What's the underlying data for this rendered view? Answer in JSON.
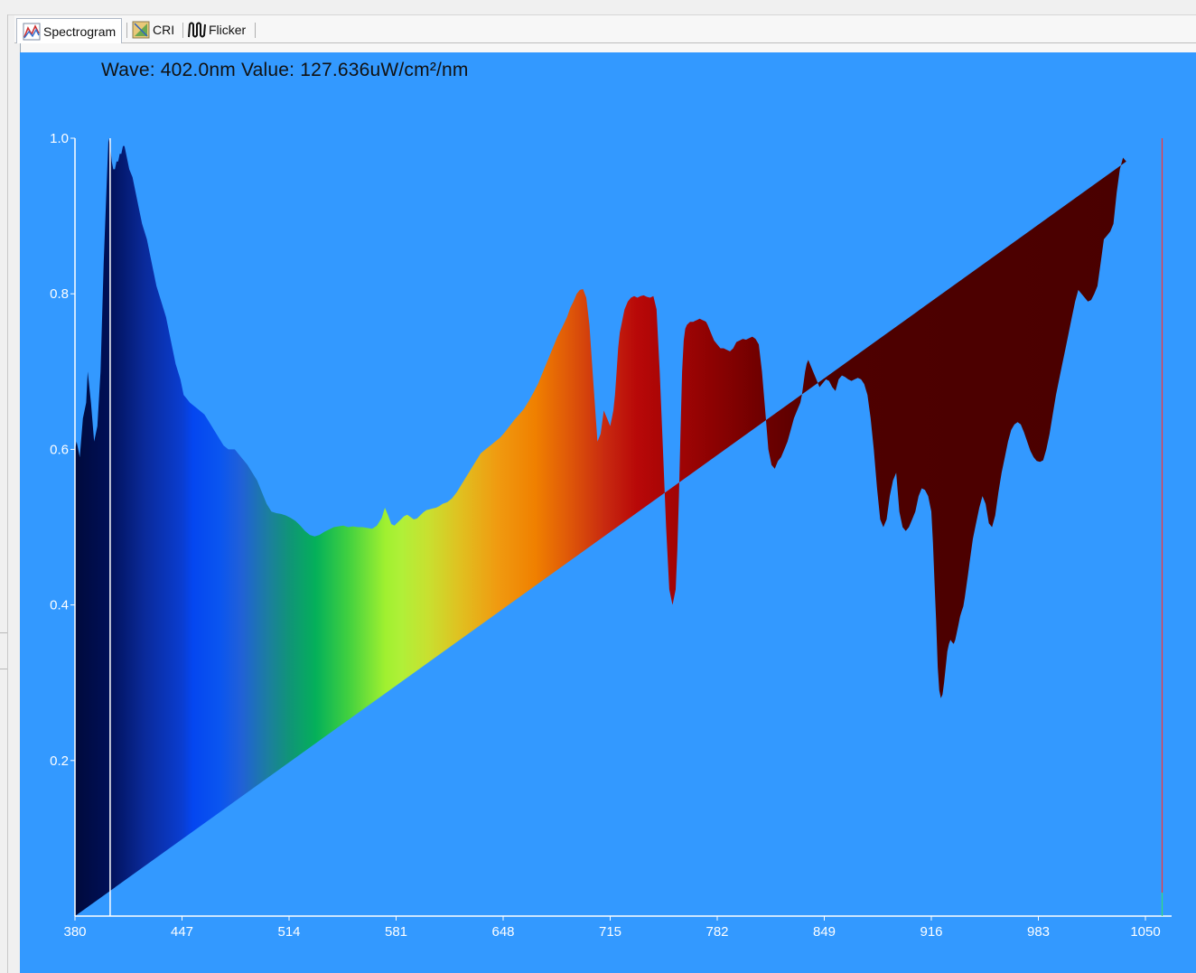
{
  "tabs": [
    {
      "label": "Spectrogram",
      "icon": "spectrogram-icon",
      "active": true
    },
    {
      "label": "CRI",
      "icon": "cri-icon",
      "active": false
    },
    {
      "label": "Flicker",
      "icon": "flicker-icon",
      "active": false
    }
  ],
  "readout": {
    "wave_label": "Wave:",
    "wave_value": "402.0nm",
    "value_label": "Value:",
    "value_value": "127.636uW/cm²/nm"
  },
  "colors": {
    "plot_background": "#3399ff",
    "axis": "#ffffff",
    "cursor_line": "#ffffff",
    "marker_red": "#ff3333",
    "marker_green": "#33dd77"
  },
  "chart_data": {
    "type": "area",
    "title": "",
    "xlabel": "",
    "ylabel": "",
    "xlim": [
      380,
      1050
    ],
    "ylim": [
      0,
      1.0
    ],
    "x_ticks": [
      "380",
      "447",
      "514",
      "581",
      "648",
      "715",
      "782",
      "849",
      "916",
      "983",
      "1050"
    ],
    "y_ticks": [
      "0.2",
      "0.4",
      "0.6",
      "0.8",
      "1.0"
    ],
    "cursor_wavelength": 402.0,
    "end_marker_wavelength": 1060,
    "x": [
      380,
      381,
      383,
      385,
      387,
      388,
      390,
      392,
      394,
      396,
      398,
      400,
      401,
      402,
      403,
      404,
      405,
      406,
      407,
      408,
      409,
      410,
      411,
      412,
      414,
      416,
      418,
      420,
      422,
      425,
      428,
      431,
      434,
      437,
      440,
      443,
      446,
      448,
      450,
      452,
      455,
      458,
      461,
      464,
      467,
      470,
      473,
      476,
      480,
      484,
      488,
      491,
      494,
      497,
      500,
      503,
      506,
      509,
      512,
      515,
      518,
      521,
      524,
      527,
      530,
      533,
      536,
      539,
      542,
      545,
      548,
      551,
      554,
      557,
      560,
      563,
      566,
      569,
      572,
      574,
      576,
      578,
      580,
      582,
      584,
      586,
      588,
      590,
      592,
      594,
      596,
      598,
      600,
      602,
      604,
      606,
      608,
      610,
      613,
      616,
      619,
      622,
      625,
      628,
      631,
      634,
      637,
      640,
      643,
      646,
      649,
      652,
      655,
      658,
      661,
      664,
      667,
      670,
      673,
      676,
      679,
      682,
      685,
      688,
      690,
      692,
      694,
      696,
      698,
      700,
      702,
      704,
      706,
      707,
      709,
      711,
      713,
      715,
      716,
      717,
      718,
      719,
      720,
      721,
      722,
      723,
      724,
      725,
      726,
      728,
      730,
      732,
      734,
      736,
      738,
      740,
      742,
      744,
      746,
      748,
      750,
      752,
      754,
      756,
      757,
      758,
      759,
      760,
      761,
      762,
      763,
      764,
      765,
      766,
      767,
      768,
      769,
      770,
      771,
      772,
      773,
      774,
      775,
      776,
      778,
      780,
      782,
      784,
      786,
      788,
      790,
      792,
      794,
      796,
      798,
      800,
      802,
      804,
      806,
      808,
      810,
      812,
      814,
      816,
      818,
      820,
      822,
      824,
      826,
      828,
      830,
      832,
      834,
      835,
      836,
      837,
      838,
      839,
      840,
      842,
      844,
      846,
      848,
      850,
      852,
      854,
      856,
      858,
      860,
      862,
      864,
      866,
      868,
      870,
      872,
      874,
      876,
      878,
      880,
      882,
      884,
      886,
      888,
      890,
      892,
      894,
      896,
      898,
      900,
      902,
      904,
      906,
      908,
      910,
      912,
      914,
      916,
      917,
      918,
      919,
      920,
      921,
      922,
      923,
      924,
      925,
      926,
      927,
      928,
      929,
      930,
      931,
      932,
      933,
      934,
      935,
      936,
      937,
      938,
      939,
      940,
      941,
      942,
      944,
      946,
      948,
      950,
      952,
      954,
      956,
      958,
      960,
      962,
      964,
      966,
      968,
      970,
      972,
      974,
      976,
      978,
      980,
      982,
      984,
      986,
      988,
      990,
      992,
      994,
      996,
      998,
      1000,
      1002,
      1004,
      1006,
      1008,
      1010,
      1012,
      1014,
      1016,
      1018,
      1020,
      1022,
      1024,
      1026,
      1028,
      1030,
      1032,
      1034,
      1036,
      1038,
      1040,
      1042,
      1044,
      1046,
      1048,
      1049,
      1050
    ],
    "values": [
      0.6,
      0.61,
      0.59,
      0.64,
      0.66,
      0.7,
      0.66,
      0.61,
      0.63,
      0.7,
      0.84,
      0.95,
      1.0,
      0.99,
      0.97,
      0.96,
      0.96,
      0.97,
      0.97,
      0.98,
      0.98,
      0.99,
      0.99,
      0.98,
      0.96,
      0.95,
      0.93,
      0.91,
      0.89,
      0.87,
      0.84,
      0.81,
      0.79,
      0.77,
      0.74,
      0.71,
      0.69,
      0.67,
      0.665,
      0.66,
      0.655,
      0.65,
      0.645,
      0.635,
      0.625,
      0.615,
      0.605,
      0.6,
      0.6,
      0.59,
      0.58,
      0.57,
      0.56,
      0.545,
      0.53,
      0.52,
      0.518,
      0.517,
      0.515,
      0.512,
      0.508,
      0.502,
      0.495,
      0.49,
      0.488,
      0.49,
      0.494,
      0.497,
      0.5,
      0.501,
      0.502,
      0.5,
      0.501,
      0.5,
      0.5,
      0.499,
      0.498,
      0.502,
      0.512,
      0.525,
      0.515,
      0.504,
      0.502,
      0.506,
      0.51,
      0.514,
      0.516,
      0.513,
      0.51,
      0.511,
      0.515,
      0.519,
      0.522,
      0.523,
      0.524,
      0.525,
      0.527,
      0.53,
      0.532,
      0.537,
      0.545,
      0.555,
      0.565,
      0.575,
      0.585,
      0.595,
      0.6,
      0.605,
      0.61,
      0.615,
      0.622,
      0.63,
      0.638,
      0.645,
      0.652,
      0.662,
      0.673,
      0.685,
      0.7,
      0.715,
      0.73,
      0.745,
      0.757,
      0.77,
      0.782,
      0.79,
      0.8,
      0.805,
      0.806,
      0.795,
      0.76,
      0.7,
      0.64,
      0.61,
      0.62,
      0.65,
      0.64,
      0.63,
      0.64,
      0.65,
      0.67,
      0.7,
      0.73,
      0.75,
      0.76,
      0.77,
      0.78,
      0.785,
      0.79,
      0.795,
      0.797,
      0.795,
      0.797,
      0.798,
      0.796,
      0.795,
      0.797,
      0.78,
      0.7,
      0.6,
      0.5,
      0.42,
      0.4,
      0.42,
      0.47,
      0.54,
      0.62,
      0.7,
      0.74,
      0.755,
      0.76,
      0.762,
      0.764,
      0.764,
      0.764,
      0.765,
      0.766,
      0.767,
      0.768,
      0.767,
      0.766,
      0.765,
      0.764,
      0.76,
      0.75,
      0.74,
      0.735,
      0.73,
      0.73,
      0.728,
      0.726,
      0.73,
      0.738,
      0.74,
      0.742,
      0.741,
      0.743,
      0.745,
      0.742,
      0.735,
      0.7,
      0.65,
      0.6,
      0.58,
      0.575,
      0.585,
      0.59,
      0.6,
      0.61,
      0.625,
      0.64,
      0.65,
      0.66,
      0.67,
      0.685,
      0.7,
      0.71,
      0.715,
      0.71,
      0.7,
      0.69,
      0.68,
      0.685,
      0.69,
      0.688,
      0.68,
      0.675,
      0.69,
      0.695,
      0.693,
      0.69,
      0.688,
      0.69,
      0.692,
      0.69,
      0.684,
      0.67,
      0.64,
      0.6,
      0.55,
      0.51,
      0.5,
      0.51,
      0.54,
      0.56,
      0.57,
      0.52,
      0.5,
      0.495,
      0.5,
      0.51,
      0.52,
      0.54,
      0.55,
      0.548,
      0.54,
      0.52,
      0.48,
      0.43,
      0.38,
      0.32,
      0.29,
      0.28,
      0.285,
      0.3,
      0.32,
      0.34,
      0.35,
      0.355,
      0.352,
      0.35,
      0.355,
      0.365,
      0.375,
      0.385,
      0.392,
      0.398,
      0.41,
      0.425,
      0.44,
      0.455,
      0.47,
      0.485,
      0.505,
      0.525,
      0.54,
      0.53,
      0.505,
      0.5,
      0.515,
      0.545,
      0.57,
      0.59,
      0.61,
      0.625,
      0.632,
      0.635,
      0.632,
      0.622,
      0.61,
      0.598,
      0.59,
      0.585,
      0.584,
      0.586,
      0.6,
      0.62,
      0.645,
      0.67,
      0.69,
      0.71,
      0.73,
      0.75,
      0.77,
      0.79,
      0.805,
      0.8,
      0.795,
      0.79,
      0.792,
      0.8,
      0.81,
      0.84,
      0.87,
      0.875,
      0.88,
      0.89,
      0.93,
      0.96,
      0.975,
      0.97
    ]
  }
}
